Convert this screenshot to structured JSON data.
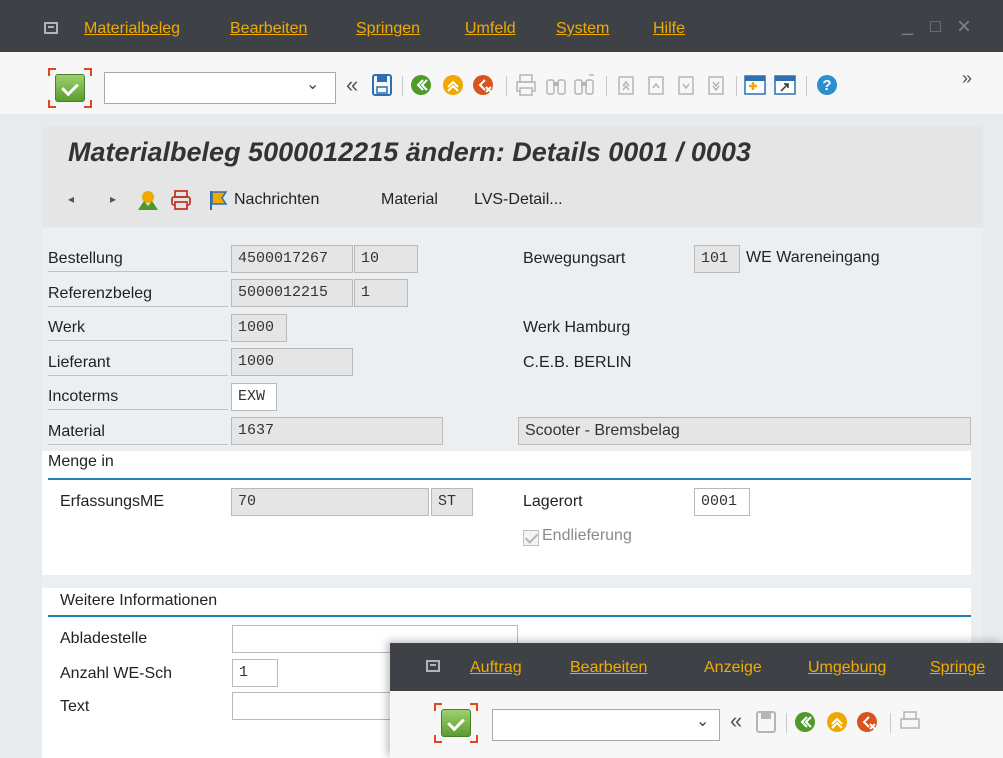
{
  "menu": {
    "items": [
      "Materialbeleg",
      "Bearbeiten",
      "Springen",
      "Umfeld",
      "System",
      "Hilfe"
    ]
  },
  "window_controls": {
    "minimize": "_",
    "maximize": "□",
    "close": "×"
  },
  "toolbar": {
    "command_value": "",
    "dropdown_glyph": "⌄",
    "back_glyph": "«",
    "more_glyph": "»"
  },
  "page": {
    "title": "Materialbeleg 5000012215 ändern: Details 0001 / 0003"
  },
  "appbar": {
    "prev_glyph": "◂",
    "next_glyph": "▸",
    "buttons": [
      "Nachrichten",
      "Material",
      "LVS-Detail..."
    ]
  },
  "header": {
    "bestellung": {
      "label": "Bestellung",
      "value": "4500017267",
      "item": "10"
    },
    "referenzbeleg": {
      "label": "Referenzbeleg",
      "value": "5000012215",
      "item": "1"
    },
    "werk": {
      "label": "Werk",
      "value": "1000",
      "text": "Werk Hamburg"
    },
    "lieferant": {
      "label": "Lieferant",
      "value": "1000",
      "text": "C.E.B. BERLIN"
    },
    "incoterms": {
      "label": "Incoterms",
      "value": "EXW"
    },
    "material": {
      "label": "Material",
      "value": "1637",
      "text": "Scooter - Bremsbelag"
    },
    "bewegungsart": {
      "label": "Bewegungsart",
      "code": "101",
      "text": "WE Wareneingang"
    }
  },
  "menge_group": {
    "title": "Menge in",
    "erfassungsme": {
      "label": "ErfassungsME",
      "value": "70",
      "unit": "ST"
    },
    "lagerort": {
      "label": "Lagerort",
      "value": "0001"
    },
    "endlieferung": {
      "label": "Endlieferung",
      "checked": true,
      "disabled": true
    }
  },
  "weitere_group": {
    "title": "Weitere Informationen",
    "abladestelle": {
      "label": "Abladestelle",
      "value": ""
    },
    "anzahl_we_sch": {
      "label": "Anzahl WE-Sch",
      "value": "1"
    },
    "text": {
      "label": "Text",
      "value": ""
    }
  },
  "second_window": {
    "menu_items": [
      "Auftrag",
      "Bearbeiten",
      "Anzeige",
      "Umgebung",
      "Springe"
    ],
    "command_value": ""
  },
  "colors": {
    "titlebar": "#3e4247",
    "menu_text": "#f0ab00",
    "group_line": "#2680b8",
    "ok_green": "#5a9c2e",
    "focus_red": "#e0451b"
  },
  "icons": {
    "toolbar": [
      "enter-check-icon",
      "save-icon",
      "back-icon",
      "exit-icon",
      "cancel-icon",
      "print-icon",
      "find-icon",
      "find-next-icon",
      "first-page-icon",
      "previous-page-icon",
      "next-page-icon",
      "last-page-icon",
      "create-session-icon",
      "shortcut-icon",
      "help-icon"
    ],
    "appbar": [
      "previous-item-icon",
      "next-item-icon",
      "material-overview-icon",
      "print-output-icon",
      "messages-icon"
    ]
  }
}
